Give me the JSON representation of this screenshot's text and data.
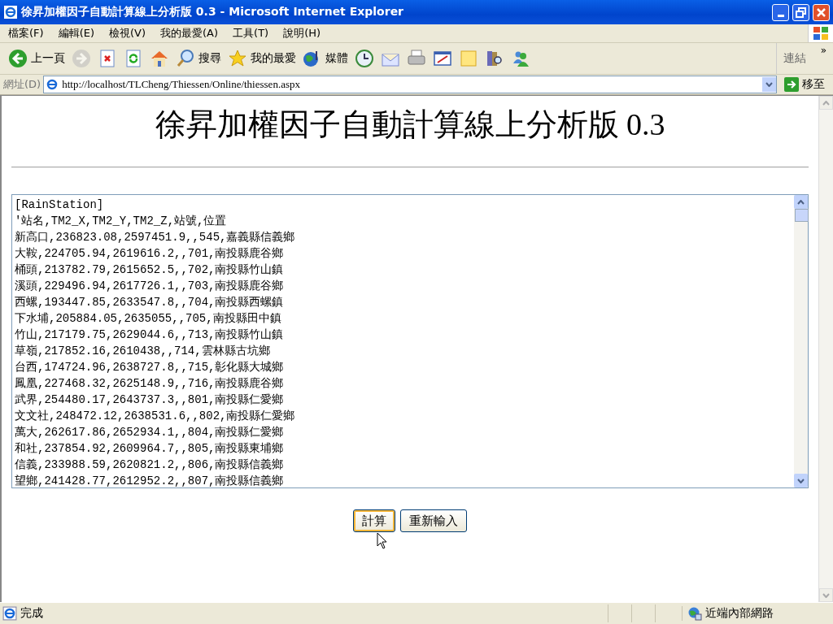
{
  "window": {
    "title": "徐昇加權因子自動計算線上分析版 0.3 - Microsoft Internet Explorer"
  },
  "menu": [
    "檔案(F)",
    "編輯(E)",
    "檢視(V)",
    "我的最愛(A)",
    "工具(T)",
    "說明(H)"
  ],
  "toolbar": [
    {
      "kind": "back",
      "label": "上一頁",
      "disabled": false
    },
    {
      "kind": "forward",
      "disabled": true
    },
    {
      "kind": "stop",
      "disabled": false
    },
    {
      "kind": "refresh",
      "disabled": false
    },
    {
      "kind": "home",
      "disabled": false
    },
    {
      "kind": "search",
      "label": "搜尋",
      "disabled": false
    },
    {
      "kind": "favorites",
      "label": "我的最愛",
      "disabled": false
    },
    {
      "kind": "media",
      "label": "媒體",
      "disabled": false
    },
    {
      "kind": "history",
      "disabled": false
    },
    {
      "kind": "mail",
      "disabled": false
    },
    {
      "kind": "print",
      "disabled": false
    },
    {
      "kind": "edit",
      "disabled": false
    },
    {
      "kind": "note",
      "disabled": false
    },
    {
      "kind": "research",
      "disabled": false
    },
    {
      "kind": "messenger",
      "disabled": false
    }
  ],
  "links": {
    "label": "連結",
    "chevron": "»"
  },
  "address": {
    "label": "網址(D)",
    "value": "http://localhost/TLCheng/Thiessen/Online/thiessen.aspx",
    "go": "移至"
  },
  "page": {
    "heading": "徐昇加權因子自動計算線上分析版 0.3",
    "lines": [
      "[RainStation]",
      "'站名,TM2_X,TM2_Y,TM2_Z,站號,位置",
      "新高口,236823.08,2597451.9,,545,嘉義縣信義鄉",
      "大鞍,224705.94,2619616.2,,701,南投縣鹿谷鄉",
      "桶頭,213782.79,2615652.5,,702,南投縣竹山鎮",
      "溪頭,229496.94,2617726.1,,703,南投縣鹿谷鄉",
      "西螺,193447.85,2633547.8,,704,南投縣西螺鎮",
      "下水埔,205884.05,2635055,,705,南投縣田中鎮",
      "竹山,217179.75,2629044.6,,713,南投縣竹山鎮",
      "草嶺,217852.16,2610438,,714,雲林縣古坑鄉",
      "台西,174724.96,2638727.8,,715,彰化縣大城鄉",
      "鳳凰,227468.32,2625148.9,,716,南投縣鹿谷鄉",
      "武界,254480.17,2643737.3,,801,南投縣仁愛鄉",
      "文文社,248472.12,2638531.6,,802,南投縣仁愛鄉",
      "萬大,262617.86,2652934.1,,804,南投縣仁愛鄉",
      "和社,237854.92,2609964.7,,805,南投縣東埔鄉",
      "信義,233988.59,2620821.2,,806,南投縣信義鄉",
      "望鄉,241428.77,2612952.2,,807,南投縣信義鄉"
    ],
    "buttons": [
      {
        "label": "計算",
        "focused": true
      },
      {
        "label": "重新輸入",
        "focused": false
      }
    ]
  },
  "status_bar": {
    "text": "完成",
    "zone": "近端內部網路"
  }
}
